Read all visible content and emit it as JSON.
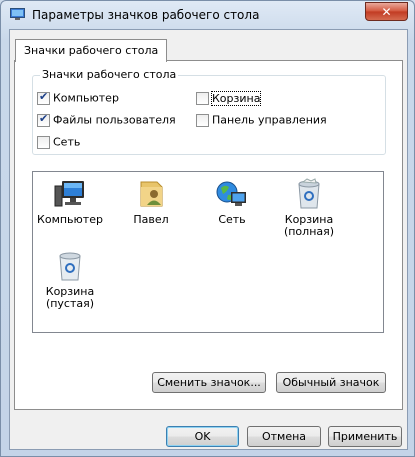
{
  "window": {
    "title": "Параметры значков рабочего стола",
    "close_symbol": "✕"
  },
  "tabs": [
    {
      "label": "Значки рабочего стола",
      "selected": true
    }
  ],
  "group": {
    "label": "Значки рабочего стола",
    "checkboxes": [
      {
        "label": "Компьютер",
        "checked": true
      },
      {
        "label": "Корзина",
        "checked": false
      },
      {
        "label": "Файлы пользователя",
        "checked": true
      },
      {
        "label": "Панель управления",
        "checked": false
      },
      {
        "label": "Сеть",
        "checked": false
      }
    ]
  },
  "icons": [
    {
      "label": "Компьютер",
      "icon": "computer-icon"
    },
    {
      "label": "Павел",
      "icon": "user-folder-icon"
    },
    {
      "label": "Сеть",
      "icon": "network-globe-icon"
    },
    {
      "label": "Корзина (полная)",
      "icon": "recycle-bin-full-icon"
    },
    {
      "label": "Корзина (пустая)",
      "icon": "recycle-bin-empty-icon"
    }
  ],
  "buttons": {
    "change_icon": "Сменить значок...",
    "restore_default": "Обычный значок",
    "ok": "OK",
    "cancel": "Отмена",
    "apply": "Применить"
  }
}
